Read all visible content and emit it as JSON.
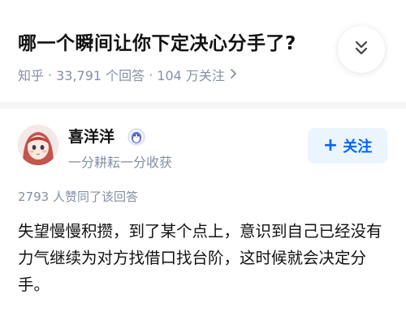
{
  "question": {
    "title": "哪一个瞬间让你下定决心分手了?",
    "source": "知乎",
    "answers_count": "33,791 个回答",
    "followers_count": "104 万关注",
    "meta_separator": "·"
  },
  "answer": {
    "author_name": "喜洋洋",
    "author_bio": "一分耕耘一分收获",
    "follow_label": "关注",
    "follow_icon": "+",
    "vote_text": "2793 人赞同了该回答",
    "content": "失望慢慢积攒，到了某个点上，意识到自己已经没有力气继续为对方找借口找台阶，这时候就会决定分手。"
  },
  "colors": {
    "accent": "#0066ff",
    "accent_bg": "#ebf5ff",
    "meta_gray": "#8590a6",
    "text": "#121212",
    "divider": "#f6f6f6"
  },
  "icons": {
    "collapse": "double-chevron-down-icon",
    "meta_arrow": "chevron-right-icon",
    "badge": "penguin-badge-icon",
    "follow": "plus-icon"
  }
}
